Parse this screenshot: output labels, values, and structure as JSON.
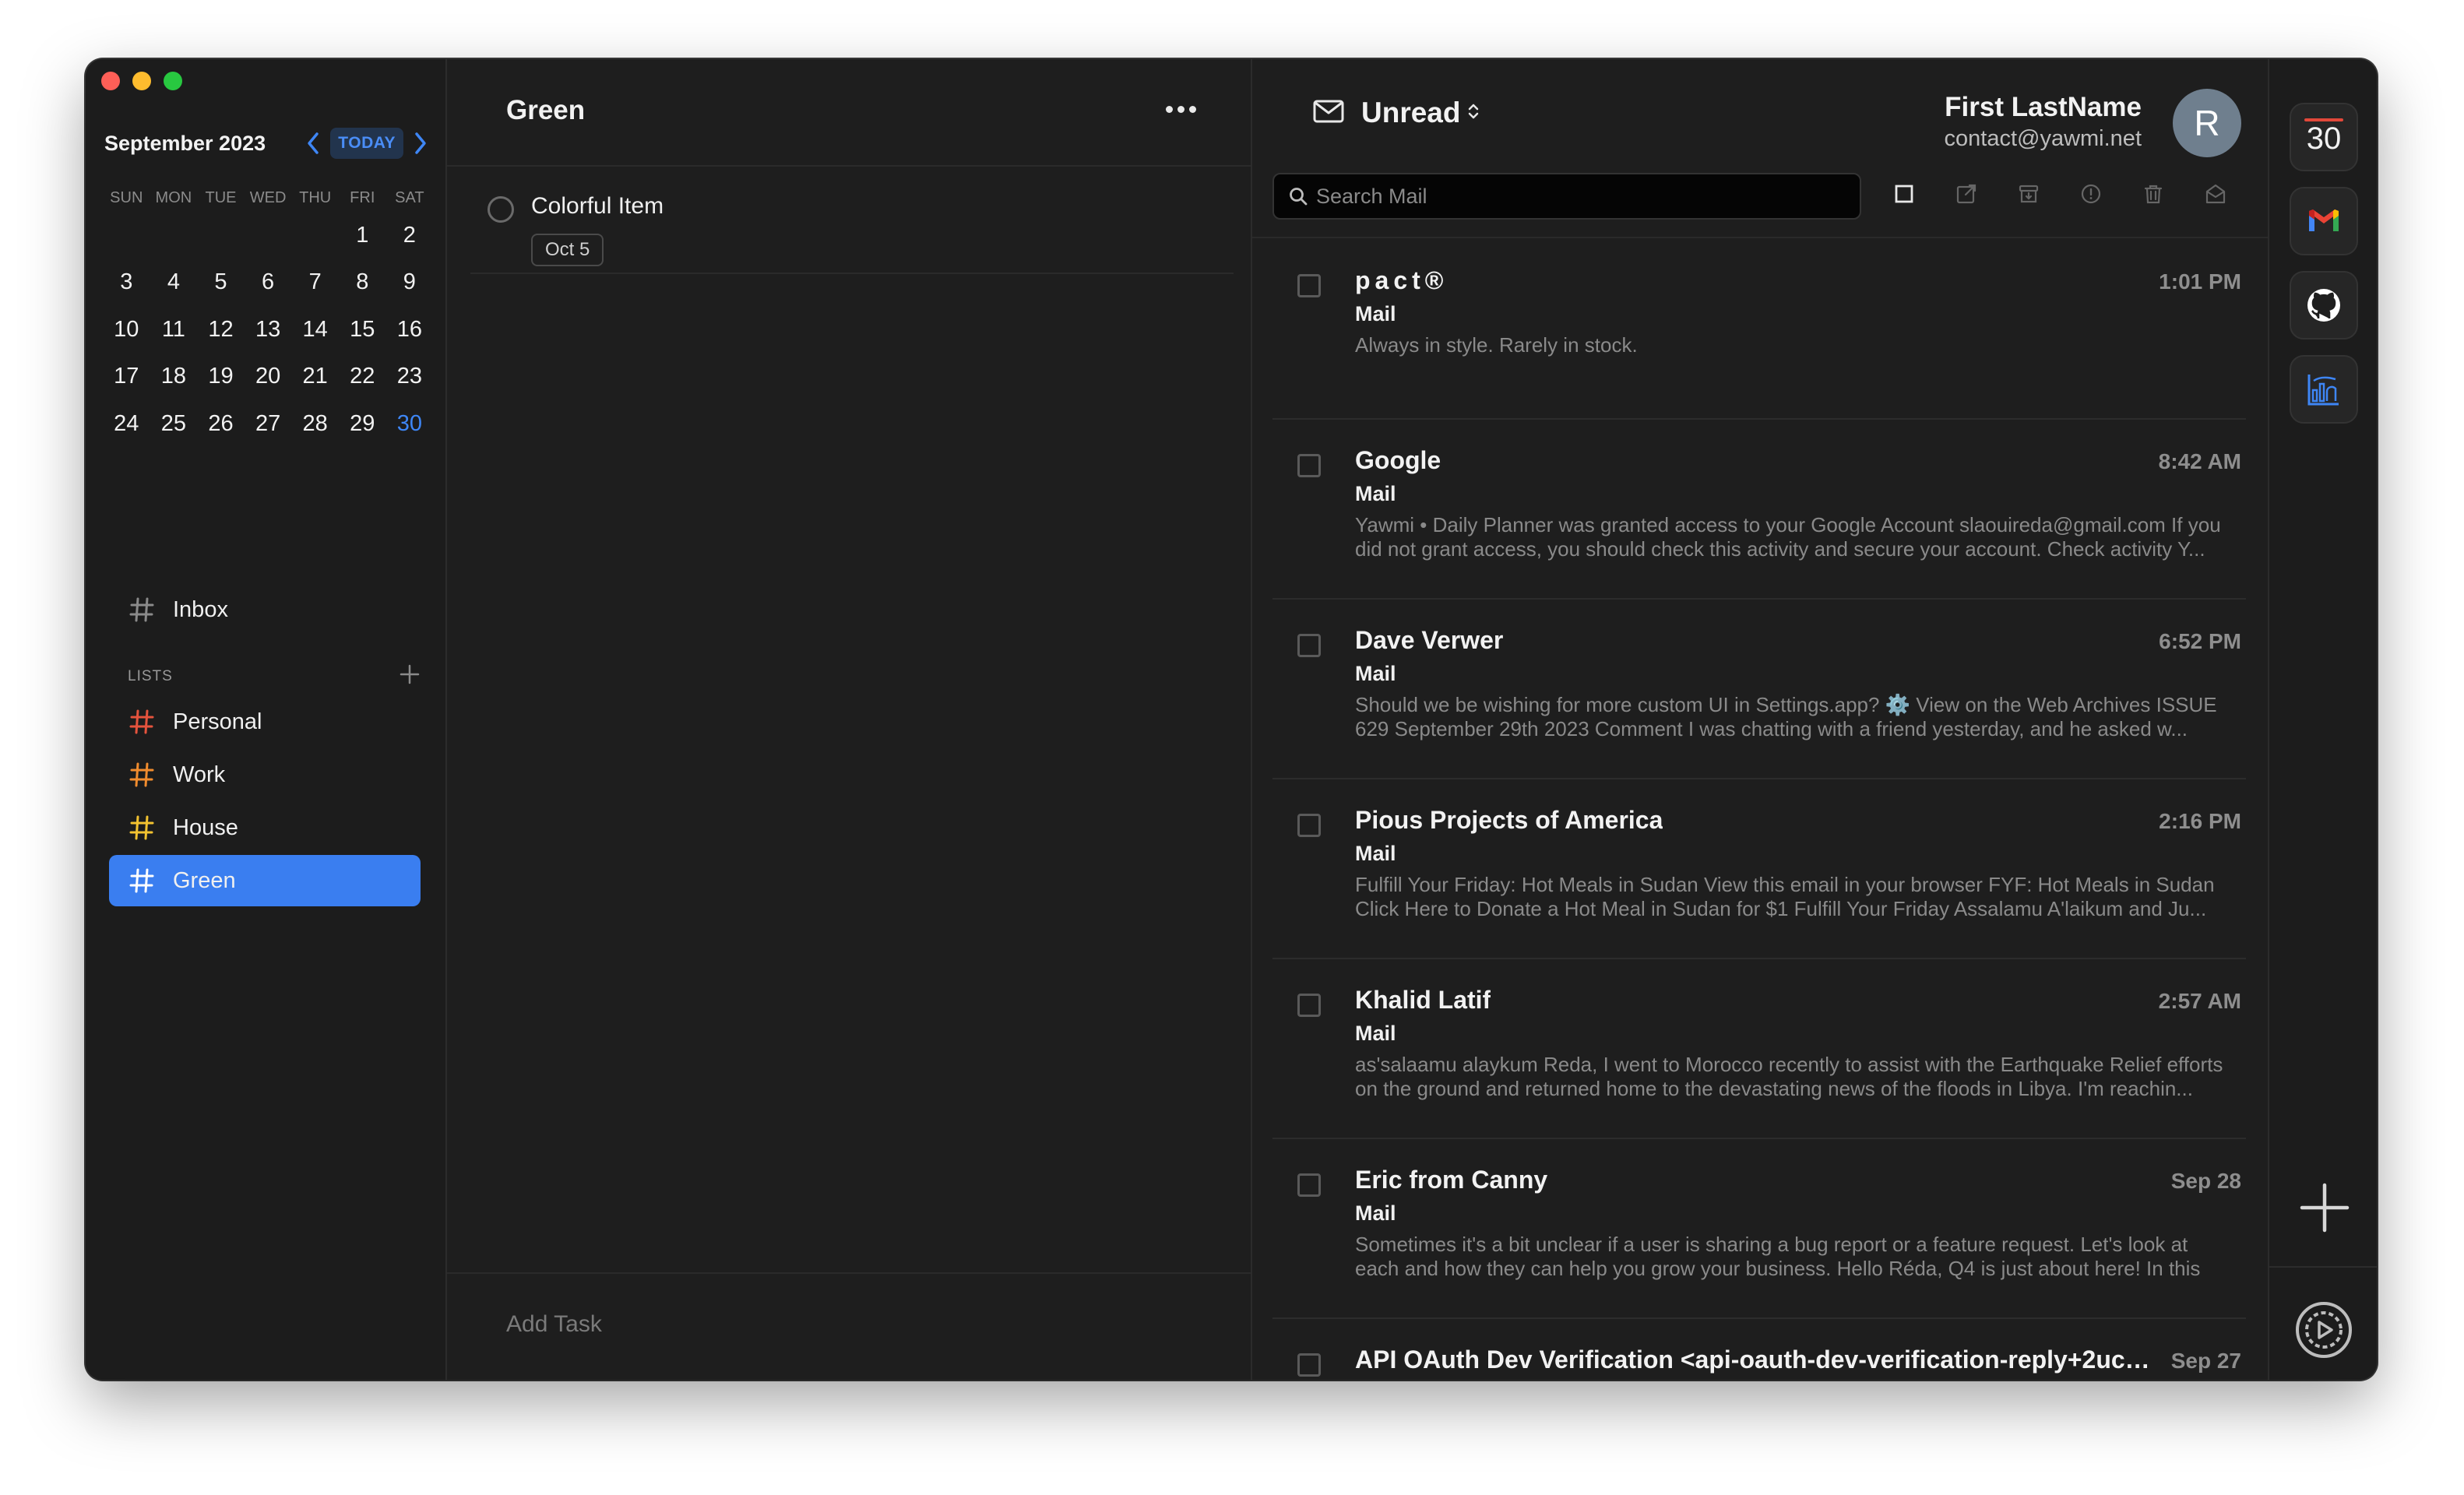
{
  "calendar": {
    "month": "September 2023",
    "today_label": "TODAY",
    "weekdays": [
      "SUN",
      "MON",
      "TUE",
      "WED",
      "THU",
      "FRI",
      "SAT"
    ],
    "weeks": [
      [
        "",
        "",
        "",
        "",
        "",
        "1",
        "2"
      ],
      [
        "3",
        "4",
        "5",
        "6",
        "7",
        "8",
        "9"
      ],
      [
        "10",
        "11",
        "12",
        "13",
        "14",
        "15",
        "16"
      ],
      [
        "17",
        "18",
        "19",
        "20",
        "21",
        "22",
        "23"
      ],
      [
        "24",
        "25",
        "26",
        "27",
        "28",
        "29",
        "30"
      ]
    ],
    "highlight_day": "30",
    "highlight_color": "#3e86f5"
  },
  "sidebar": {
    "inbox": {
      "label": "Inbox",
      "icon": "hash-icon",
      "color": "#8a8a8a"
    },
    "lists_header": "LISTS",
    "lists": [
      {
        "label": "Personal",
        "icon": "hash-icon",
        "color": "#e5533d"
      },
      {
        "label": "Work",
        "icon": "hash-icon",
        "color": "#f08c2e"
      },
      {
        "label": "House",
        "icon": "hash-icon",
        "color": "#f2c230"
      },
      {
        "label": "Green",
        "icon": "hash-icon",
        "color": "#ffffff",
        "active": true
      }
    ],
    "active_color": "#3a7ef0"
  },
  "tasks": {
    "title": "Green",
    "items": [
      {
        "title": "Colorful Item",
        "date": "Oct 5"
      }
    ],
    "add_placeholder": "Add Task"
  },
  "mail": {
    "mailbox": "Unread",
    "account_name": "First LastName",
    "account_email": "contact@yawmi.net",
    "avatar_initial": "R",
    "search_placeholder": "Search Mail",
    "toolbar": [
      "select-all-icon",
      "open-external-icon",
      "archive-icon",
      "spam-icon",
      "trash-icon",
      "mark-read-icon"
    ],
    "messages": [
      {
        "sender": "pact®",
        "time": "1:01 PM",
        "tag": "Mail",
        "preview": "Always in style. Rarely in stock."
      },
      {
        "sender": "Google",
        "time": "8:42 AM",
        "tag": "Mail",
        "preview": "Yawmi • Daily Planner was granted access to your Google Account slaouireda@gmail.com If you did not grant access, you should check this activity and secure your account. Check activity Y..."
      },
      {
        "sender": "Dave Verwer",
        "time": "6:52 PM",
        "tag": "Mail",
        "preview": "Should we be wishing for more custom UI in Settings.app? ⚙️ View on the Web Archives ISSUE 629 September 29th 2023 Comment I was chatting with a friend yesterday, and he asked w..."
      },
      {
        "sender": "Pious Projects of America",
        "time": "2:16 PM",
        "tag": "Mail",
        "preview": "Fulfill Your Friday: Hot Meals in Sudan View this email in your browser FYF: Hot Meals in Sudan Click Here to Donate a Hot Meal in Sudan for $1 Fulfill Your Friday Assalamu A'laikum and Ju..."
      },
      {
        "sender": "Khalid Latif",
        "time": "2:57 AM",
        "tag": "Mail",
        "preview": "as'salaamu alaykum Reda, I went to Morocco recently to assist with the Earthquake Relief efforts on the ground and returned home to the devastating news of the floods in Libya. I'm reachin..."
      },
      {
        "sender": "Eric from Canny",
        "time": "Sep 28",
        "tag": "Mail",
        "preview": "Sometimes it's a bit unclear if a user is sharing a bug report or a feature request. Let's look at each and how they can help you grow your business. Hello Réda, Q4 is just about here! In this"
      },
      {
        "sender": "API OAuth Dev Verification <api-oauth-dev-verification-reply+2uccmp...",
        "time": "Sep 27",
        "tag": "",
        "preview": ""
      }
    ]
  },
  "rail": {
    "calendar_day": "30",
    "apps": [
      "calendar-icon",
      "gmail-icon",
      "github-icon",
      "chart-icon"
    ],
    "add": "plus-icon",
    "settings": "settings-icon"
  }
}
